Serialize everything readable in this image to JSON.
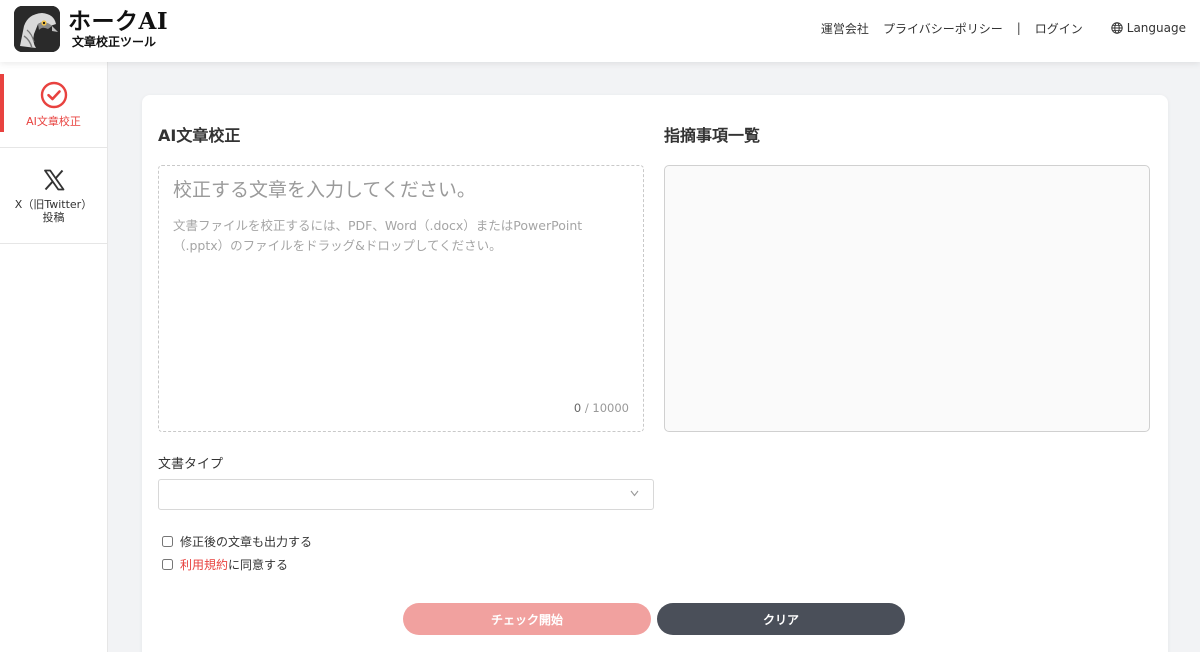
{
  "header": {
    "brand_title": "ホークAI",
    "brand_subtitle": "文章校正ツール",
    "nav": {
      "company": "運営会社",
      "privacy": "プライバシーポリシー",
      "separator": "|",
      "login": "ログイン",
      "language": "Language"
    }
  },
  "sidebar": {
    "items": [
      {
        "label": "AI文章校正",
        "icon": "check-circle-icon",
        "active": true
      },
      {
        "label_line1": "X（旧Twitter）",
        "label_line2": "投稿",
        "icon": "x-logo-icon",
        "active": false
      }
    ]
  },
  "main": {
    "editor_title": "AI文章校正",
    "results_title": "指摘事項一覧",
    "editor": {
      "placeholder": "校正する文章を入力してください。",
      "hint": "文書ファイルを校正するには、PDF、Word（.docx）またはPowerPoint（.pptx）のファイルをドラッグ&ドロップしてください。",
      "count": "0",
      "max": "/ 10000"
    },
    "doc_type_label": "文書タイプ",
    "doc_type_value": "",
    "options": {
      "output_corrected": "修正後の文章も出力する",
      "terms_link": "利用規約",
      "terms_suffix": "に同意する"
    },
    "buttons": {
      "check": "チェック開始",
      "clear": "クリア"
    }
  },
  "colors": {
    "accent": "#e8423f",
    "check_button": "#f1a19f",
    "clear_button": "#4a4f59"
  }
}
